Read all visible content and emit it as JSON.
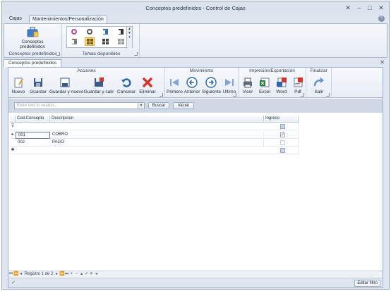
{
  "window": {
    "title": "Conceptos predefinidos - Control de Cajas"
  },
  "ribbon": {
    "tabs": [
      "Cajas",
      "Mantenimientos/Personalización"
    ],
    "groups": {
      "conceptos": {
        "button_label": "Conceptos predefinidos",
        "label": "Conceptos predefinidos"
      },
      "temas": {
        "label": "Temas disponibles"
      }
    }
  },
  "document_tab": {
    "label": "Conceptos predefinidos"
  },
  "toolbar": {
    "acciones": {
      "title": "Acciones",
      "buttons": [
        "Nuevo",
        "Guardar",
        "Guardar y nuevo",
        "Guardar y salir",
        "Cancelar",
        "Eliminar"
      ]
    },
    "movimiento": {
      "title": "Movimiento",
      "buttons": [
        "Primero",
        "Anterior",
        "Siguiente",
        "Ultimo"
      ]
    },
    "impresion": {
      "title": "Impresión/Exportación",
      "buttons": [
        "Visor",
        "Excel",
        "Word",
        "Pdf"
      ]
    },
    "finalizar": {
      "title": "Finalizar",
      "buttons": [
        "Salir"
      ]
    }
  },
  "search": {
    "placeholder": "Enter text to search...",
    "buscar_label": "Buscar",
    "vaciar_label": "Vaciar"
  },
  "grid": {
    "columns": [
      "Cod.Concepto",
      "Descripcion",
      "Ingreso"
    ],
    "rows": [
      {
        "code": "001",
        "description": "COBRO",
        "ingreso": "✓"
      },
      {
        "code": "002",
        "description": "PAGO",
        "ingreso": ""
      }
    ]
  },
  "navigator": {
    "record_text": "Registro 1 de 2"
  },
  "statusbar": {
    "edit_filter_label": "Editar filtro"
  },
  "colors": {
    "accent_blue": "#2b63b5",
    "delete_red": "#d8322a",
    "selected_theme": "#f8d97a"
  }
}
